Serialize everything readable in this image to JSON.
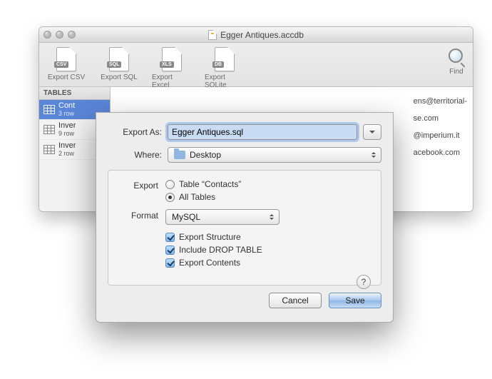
{
  "window": {
    "title": "Egger Antiques.accdb",
    "find_label": "Find"
  },
  "toolbar": [
    {
      "label": "Export CSV",
      "tag": "CSV",
      "cls": "csv"
    },
    {
      "label": "Export SQL",
      "tag": "SQL",
      "cls": "sql"
    },
    {
      "label": "Export Excel",
      "tag": "XLS",
      "cls": "xls"
    },
    {
      "label": "Export SQLite",
      "tag": "DB",
      "cls": "db"
    }
  ],
  "sidebar": {
    "header": "TABLES",
    "items": [
      {
        "name": "Cont",
        "sub": "3 row",
        "selected": true
      },
      {
        "name": "Inver",
        "sub": "9 row",
        "selected": false
      },
      {
        "name": "Inver",
        "sub": "2 row",
        "selected": false
      }
    ]
  },
  "background_rows": [
    "ens@territorial-",
    "se.com",
    "@imperium.it",
    "acebook.com"
  ],
  "sheet": {
    "export_as_label": "Export As:",
    "filename": "Egger Antiques.sql",
    "where_label": "Where:",
    "where_value": "Desktop",
    "export_group_label": "Export",
    "radio_contacts": "Table “Contacts”",
    "radio_all": "All Tables",
    "format_label": "Format",
    "format_value": "MySQL",
    "chk_structure": "Export Structure",
    "chk_drop": "Include DROP TABLE",
    "chk_contents": "Export Contents",
    "help": "?",
    "cancel": "Cancel",
    "save": "Save"
  }
}
